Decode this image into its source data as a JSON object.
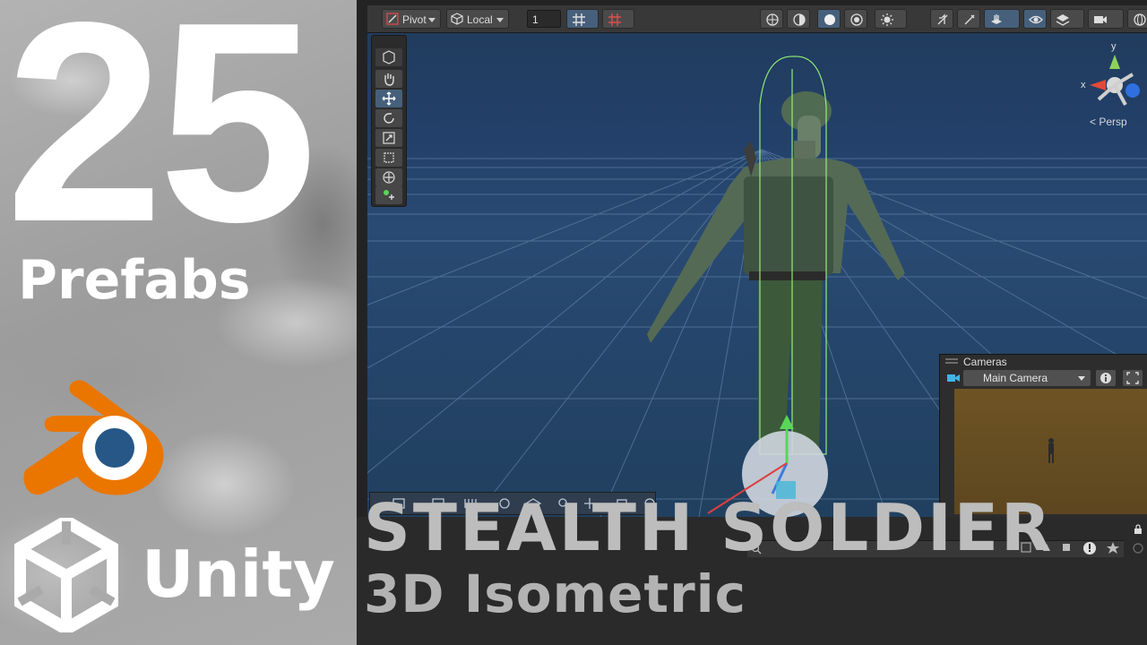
{
  "thumbnail": {
    "number": "25",
    "prefabs_label": "Prefabs",
    "unity_label": "Unity",
    "title": "STEALTH SOLDIER",
    "subtitle": "3D Isometric"
  },
  "toolbar": {
    "pivot_label": "Pivot",
    "local_label": "Local",
    "grid_value": "1"
  },
  "scene": {
    "projection_label": "Persp",
    "axis_x": "x",
    "axis_y": "y"
  },
  "cameras_panel": {
    "title": "Cameras",
    "selected_camera": "Main Camera"
  },
  "colors": {
    "blender_orange": "#ea7600",
    "blender_blue": "#265787",
    "scene_background": "#22406a",
    "active_tool": "#46607c"
  }
}
